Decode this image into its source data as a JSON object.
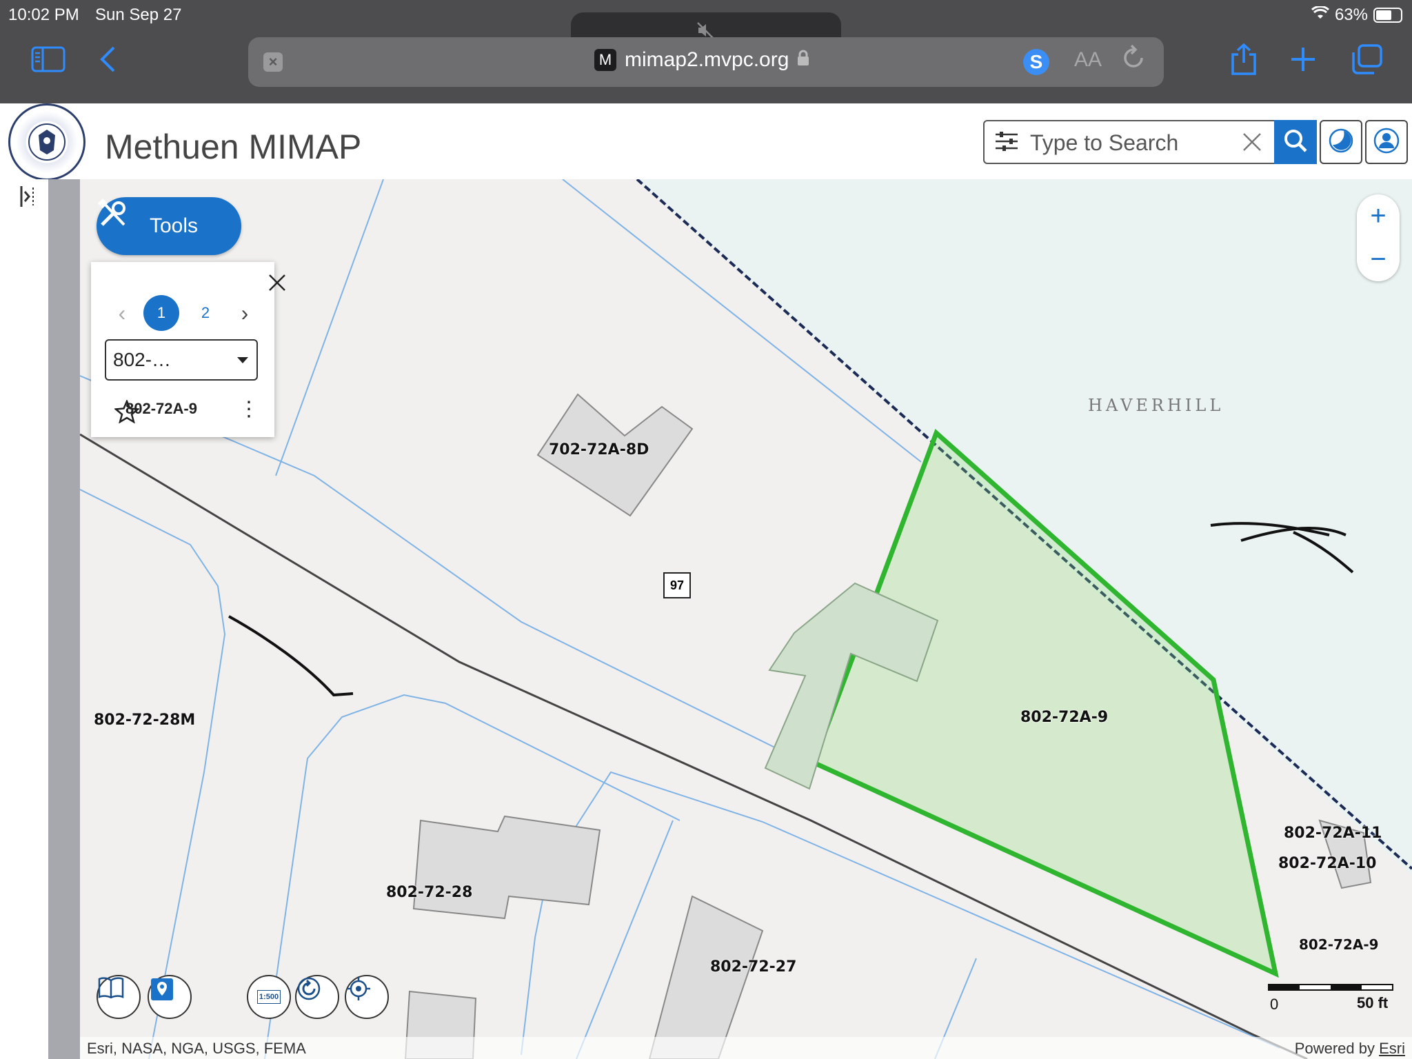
{
  "status": {
    "time": "10:02 PM",
    "date": "Sun Sep 27",
    "battery": "63%"
  },
  "browser": {
    "url": "mimap2.mvpc.org",
    "favicon_letter": "M",
    "ext_letter": "S",
    "text_size": "AA"
  },
  "app": {
    "title": "Methuen MIMAP",
    "search_placeholder": "Type to Search"
  },
  "tools": {
    "label": "Tools"
  },
  "popup": {
    "pages": [
      "1",
      "2"
    ],
    "active_page": "1",
    "select_value": "802-…",
    "item_label": "802-72A-9"
  },
  "map": {
    "town_label": "HAVERHILL",
    "route": "97",
    "parcels": [
      {
        "id": "p-702-72a-8d",
        "label": "702-72A-8D"
      },
      {
        "id": "p-802-72a-9-main",
        "label": "802-72A-9"
      },
      {
        "id": "p-802-72-28m",
        "label": "802-72-28M"
      },
      {
        "id": "p-802-72-28",
        "label": "802-72-28"
      },
      {
        "id": "p-802-72-27",
        "label": "802-72-27"
      },
      {
        "id": "p-802-72a-11",
        "label": "802-72A-11"
      },
      {
        "id": "p-802-72a-10",
        "label": "802-72A-10"
      },
      {
        "id": "p-802-72a-9-side",
        "label": "802-72A-9"
      }
    ],
    "scale": {
      "start": "0",
      "end": "50 ft"
    },
    "scale_button": "1:500",
    "attribution": "Esri, NASA, NGA, USGS, FEMA",
    "powered_by": "Powered by",
    "powered_link": "Esri",
    "highlight_color": "#2fb52f"
  }
}
